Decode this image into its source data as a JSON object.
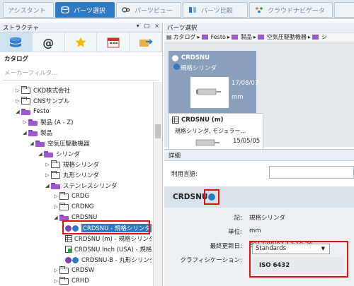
{
  "tabs": [
    {
      "label": "アシスタント",
      "icon": "assistant-icon"
    },
    {
      "label": "パーツ選択",
      "icon": "parts-select-icon",
      "active": true
    },
    {
      "label": "パーツビュー",
      "icon": "parts-view-icon"
    },
    {
      "label": "パーツ比較",
      "icon": "parts-compare-icon"
    },
    {
      "label": "クラウドナビゲータ",
      "icon": "cloud-navigator-icon"
    }
  ],
  "structure_panel": {
    "title": "ストラクチャ",
    "controls": [
      "▾",
      "□",
      "×"
    ],
    "toolbar_icons": [
      "catalog-icon",
      "at-icon",
      "favorite-star-icon",
      "calendar-icon",
      "export-icon"
    ],
    "catalog_label": "カタログ",
    "filter_placeholder": "メーカーフィルタ..."
  },
  "tree": [
    {
      "label": "CKD株式会社",
      "arrow": "▷",
      "folder": "empty"
    },
    {
      "label": "CNSサンプル",
      "arrow": "▷",
      "folder": "empty"
    },
    {
      "label": "Festo",
      "arrow": "◢",
      "folder": "open"
    },
    {
      "label": "製品 (A - Z)",
      "arrow": "▷",
      "folder": "open"
    },
    {
      "label": "製品",
      "arrow": "◢",
      "folder": "open"
    },
    {
      "label": "空気圧駆動機器",
      "arrow": "◢",
      "folder": "open"
    },
    {
      "label": "シリンダ",
      "arrow": "◢",
      "folder": "open"
    },
    {
      "label": "規格シリンダ",
      "arrow": "▷",
      "folder": "empty"
    },
    {
      "label": "丸形シリンダ",
      "arrow": "▷",
      "folder": "empty"
    },
    {
      "label": "ステンレスシリンダ",
      "arrow": "◢",
      "folder": "open"
    },
    {
      "label": "CRDG",
      "arrow": "▷",
      "folder": "empty"
    },
    {
      "label": "CRDNG",
      "arrow": "▷",
      "folder": "empty"
    },
    {
      "label": "CRDSNU",
      "arrow": "◢",
      "folder": "open"
    },
    {
      "label": "CRDSNU - 規格シリンダ",
      "arrow": "",
      "folder": "item"
    },
    {
      "label": "CRDSNU (m) - 規格シリンダ",
      "arrow": "",
      "folder": "item"
    },
    {
      "label": "CRDSNU Inch (USA) - 規格",
      "arrow": "",
      "folder": "item"
    },
    {
      "label": "CRDSNU-B - 丸形シリンダ",
      "arrow": "",
      "folder": "item"
    },
    {
      "label": "CRDSW",
      "arrow": "▷",
      "folder": "empty"
    },
    {
      "label": "CRHD",
      "arrow": "▷",
      "folder": "empty"
    }
  ],
  "parts_panel": {
    "title": "パーツ選択",
    "breadcrumb": [
      "カタログ",
      "Festo",
      "製品",
      "空気圧駆動機器",
      "シ"
    ],
    "cards": [
      {
        "name": "CRDSNU",
        "desc": "規格シリンダ",
        "date": "17/08/07",
        "unit": "mm"
      },
      {
        "name": "CRDSNU (m)",
        "desc": "規格シリンダ, モジュラー…",
        "date": "15/05/05",
        "unit": ""
      }
    ]
  },
  "detail": {
    "tab_label": "詳細",
    "language_label": "利用言語:",
    "part_name": "CRDSNU",
    "fields": [
      {
        "key": "記:",
        "value": "規格シリンダ"
      },
      {
        "key": "単位:",
        "value": "mm"
      },
      {
        "key": "最終更新日:",
        "value": "2017/08/07 13:10:26"
      },
      {
        "key": "クラフィシケーション:",
        "value": ""
      }
    ],
    "classification_select": "Standards",
    "classification_value": "ISO 6432"
  },
  "colors": {
    "accent": "#2f79c2",
    "highlight_box": "#e01010",
    "folder": "#9b59d0"
  }
}
